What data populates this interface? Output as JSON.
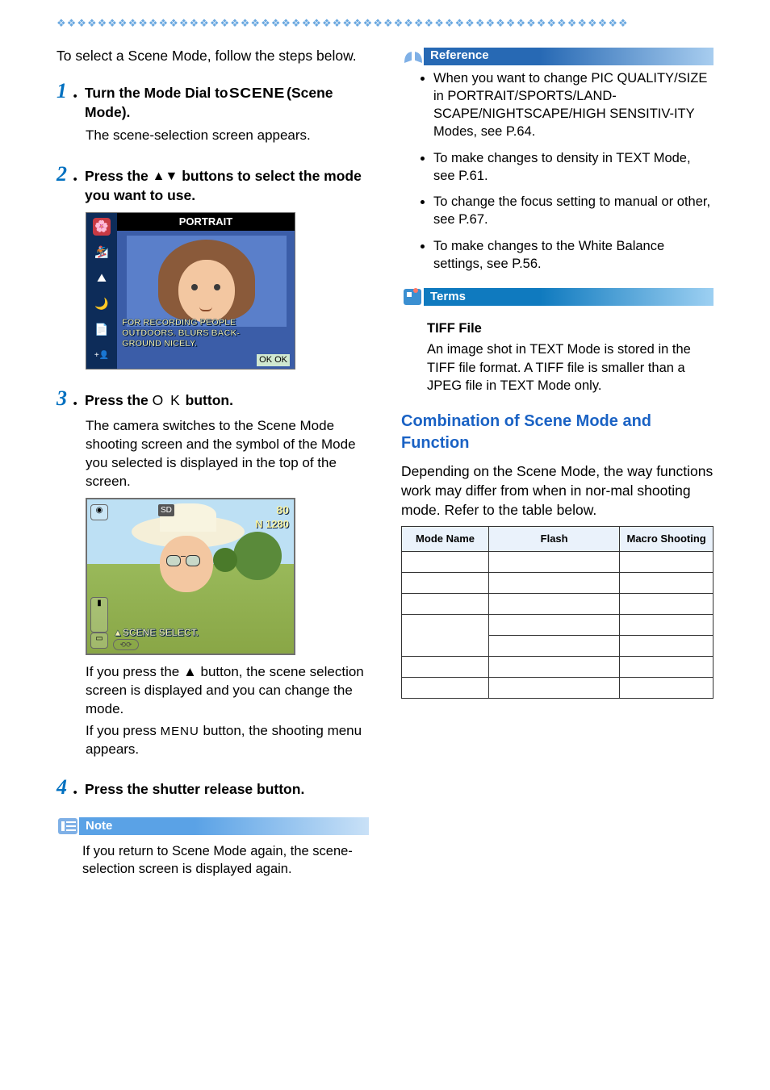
{
  "sparkles": "❖❖❖❖❖❖❖❖❖❖❖❖❖❖❖❖❖❖❖❖❖❖❖❖❖❖❖❖❖❖❖❖❖❖❖❖❖❖❖❖❖❖❖❖❖❖❖❖❖❖❖❖❖❖❖❖",
  "intro": "To select a Scene Mode, follow the steps below.",
  "steps": {
    "1": {
      "num": "1",
      "title_a": "Turn the Mode Dial to ",
      "title_scene": "SCENE",
      "title_b": " (Scene Mode).",
      "body": "The scene-selection screen appears."
    },
    "2": {
      "num": "2",
      "title_a": "Press the ",
      "title_arrows": "▲▼",
      "title_b": " buttons to select the mode you want to use."
    },
    "3": {
      "num": "3",
      "title_a": "Press the ",
      "title_ok": "O K",
      "title_b": " button.",
      "body": "The camera switches to the Scene Mode shooting screen and the symbol of the Mode you selected is displayed in the top of the screen.",
      "body2a": "If you press the ",
      "body2arrow": "▲",
      "body2b": " button, the scene selection screen is displayed and you can change the mode.",
      "body3a": "If you press ",
      "body3menu": "MENU",
      "body3b": " button, the shooting menu appears."
    },
    "4": {
      "num": "4",
      "title": "Press the shutter release button."
    }
  },
  "note": {
    "title": "Note",
    "body": "If you return to Scene Mode again, the scene-selection screen is displayed again."
  },
  "reference": {
    "title": "Reference",
    "items": [
      "When you want to change PIC QUALITY/SIZE in PORTRAIT/SPORTS/LAND-SCAPE/NIGHTSCAPE/HIGH SENSITIV-ITY Modes, see P.64.",
      "To make changes to density in TEXT Mode, see P.61.",
      "To change the focus setting to manual or other, see P.67.",
      "To make changes to the White Balance settings, see P.56."
    ]
  },
  "terms": {
    "title": "Terms",
    "heading": "TIFF File",
    "body": "An image shot in TEXT Mode is stored in the TIFF file format. A TIFF file is smaller than a JPEG file in TEXT Mode only."
  },
  "combo": {
    "title": "Combination of Scene Mode and Function",
    "body": "Depending on the Scene Mode, the way functions work may differ from when in nor-mal shooting mode. Refer to the table below.",
    "headers": [
      "Mode Name",
      "Flash",
      "Macro Shooting"
    ]
  },
  "lcd1": {
    "title": "PORTRAIT",
    "msg1": "FOR RECORDING PEOPLE",
    "msg2": "OUTDOORS. BLURS BACK-",
    "msg3": "GROUND NICELY.",
    "ok": "OK OK",
    "icons": [
      "🌸",
      "🏂",
      "🏔",
      "🌙",
      "📄",
      "+👤"
    ]
  },
  "lcd2": {
    "sd": "SD",
    "num1": "80",
    "num2": "N 1280",
    "scene": "▲SCENE",
    "select": "SELECT.",
    "oval": "⟲⟳"
  }
}
